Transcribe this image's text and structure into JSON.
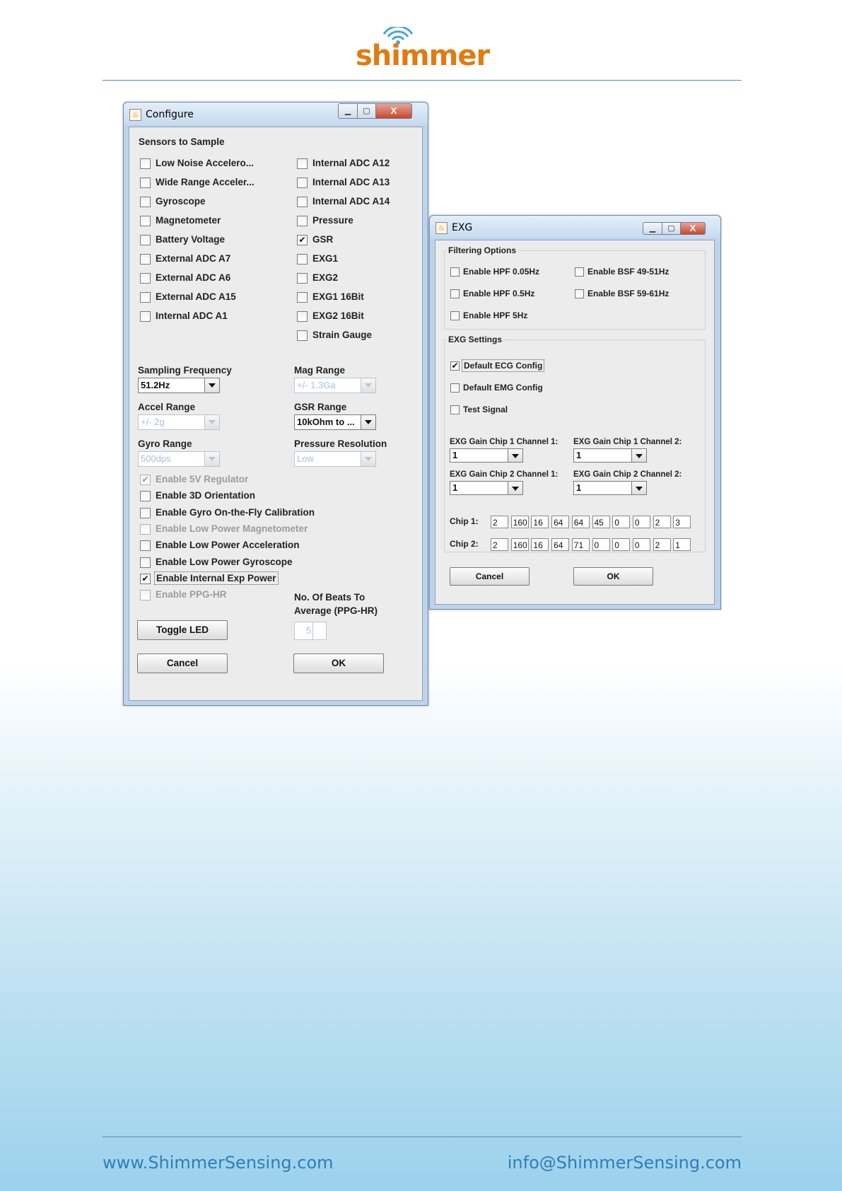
{
  "header": {
    "logo_text": "shimmer"
  },
  "footer": {
    "website": "www.ShimmerSensing.com",
    "email": "info@ShimmerSensing.com"
  },
  "configure": {
    "title": "Configure",
    "window_buttons": {
      "minimize": "▁",
      "maximize": "▢",
      "close": "X"
    },
    "sensors_heading": "Sensors to Sample",
    "sensors_left": [
      {
        "label": "Low Noise Accelero...",
        "checked": false
      },
      {
        "label": "Wide Range Acceler...",
        "checked": false
      },
      {
        "label": "Gyroscope",
        "checked": false
      },
      {
        "label": "Magnetometer",
        "checked": false
      },
      {
        "label": "Battery Voltage",
        "checked": false
      },
      {
        "label": "External ADC A7",
        "checked": false
      },
      {
        "label": "External ADC A6",
        "checked": false
      },
      {
        "label": "External ADC A15",
        "checked": false
      },
      {
        "label": "Internal ADC A1",
        "checked": false
      }
    ],
    "sensors_right": [
      {
        "label": "Internal ADC A12",
        "checked": false
      },
      {
        "label": "Internal ADC A13",
        "checked": false
      },
      {
        "label": "Internal ADC A14",
        "checked": false
      },
      {
        "label": "Pressure",
        "checked": false
      },
      {
        "label": "GSR",
        "checked": true
      },
      {
        "label": "EXG1",
        "checked": false
      },
      {
        "label": "EXG2",
        "checked": false
      },
      {
        "label": "EXG1 16Bit",
        "checked": false
      },
      {
        "label": "EXG2 16Bit",
        "checked": false
      },
      {
        "label": "Strain Gauge",
        "checked": false
      }
    ],
    "sampling_frequency": {
      "label": "Sampling Frequency",
      "value": "51.2Hz",
      "enabled": true
    },
    "mag_range": {
      "label": "Mag Range",
      "value": "+/- 1.3Ga",
      "enabled": false
    },
    "accel_range": {
      "label": "Accel Range",
      "value": "+/- 2g",
      "enabled": false
    },
    "gsr_range": {
      "label": "GSR Range",
      "value": "10kOhm to ...",
      "enabled": true
    },
    "gyro_range": {
      "label": "Gyro Range",
      "value": "500dps",
      "enabled": false
    },
    "pressure_resolution": {
      "label": "Pressure Resolution",
      "value": "Low",
      "enabled": false
    },
    "options": [
      {
        "label": "Enable 5V Regulator",
        "checked": true,
        "enabled": false
      },
      {
        "label": "Enable 3D Orientation",
        "checked": false,
        "enabled": true
      },
      {
        "label": "Enable Gyro On-the-Fly Calibration",
        "checked": false,
        "enabled": true
      },
      {
        "label": "Enable Low Power Magnetometer",
        "checked": false,
        "enabled": false
      },
      {
        "label": "Enable Low Power Acceleration",
        "checked": false,
        "enabled": true
      },
      {
        "label": "Enable Low Power Gyroscope",
        "checked": false,
        "enabled": true
      },
      {
        "label": "Enable Internal Exp Power",
        "checked": true,
        "enabled": true
      },
      {
        "label": "Enable PPG-HR",
        "checked": false,
        "enabled": false
      }
    ],
    "beats_label_1": "No. Of Beats To",
    "beats_label_2": "Average (PPG-HR)",
    "beats_value": "5",
    "toggle_led": "Toggle LED",
    "cancel": "Cancel",
    "ok": "OK"
  },
  "exg": {
    "title": "EXG",
    "window_buttons": {
      "minimize": "▁",
      "maximize": "▢",
      "close": "X"
    },
    "filtering_heading": "Filtering Options",
    "filters": [
      {
        "label": "Enable HPF 0.05Hz",
        "checked": false
      },
      {
        "label": "Enable BSF 49-51Hz",
        "checked": false
      },
      {
        "label": "Enable HPF 0.5Hz",
        "checked": false
      },
      {
        "label": "Enable BSF 59-61Hz",
        "checked": false
      },
      {
        "label": "Enable HPF 5Hz",
        "checked": false
      }
    ],
    "settings_heading": "EXG Settings",
    "settings": [
      {
        "label": "Default ECG Config",
        "checked": true
      },
      {
        "label": "Default EMG Config",
        "checked": false
      },
      {
        "label": "Test Signal",
        "checked": false
      }
    ],
    "gains": [
      {
        "label": "EXG Gain Chip 1 Channel 1:",
        "value": "1"
      },
      {
        "label": "EXG Gain Chip 1 Channel 2:",
        "value": "1"
      },
      {
        "label": "EXG Gain Chip 2 Channel 1:",
        "value": "1"
      },
      {
        "label": "EXG Gain Chip 2 Channel 2:",
        "value": "1"
      }
    ],
    "chip1_label": "Chip 1:",
    "chip1": [
      "2",
      "160",
      "16",
      "64",
      "64",
      "45",
      "0",
      "0",
      "2",
      "3"
    ],
    "chip2_label": "Chip 2:",
    "chip2": [
      "2",
      "160",
      "16",
      "64",
      "71",
      "0",
      "0",
      "0",
      "2",
      "1"
    ],
    "cancel": "Cancel",
    "ok": "OK"
  }
}
